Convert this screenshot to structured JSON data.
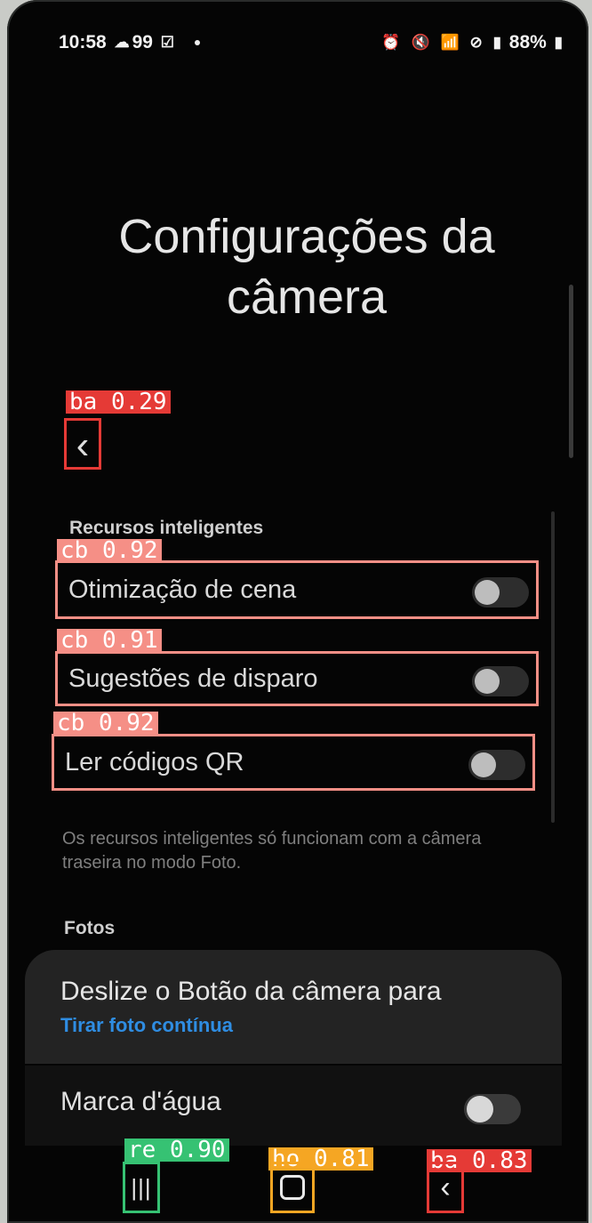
{
  "status_bar": {
    "time": "10:58",
    "left_icons": [
      "cloud-icon",
      "99",
      "check-square-icon"
    ],
    "battery": "88%",
    "right_icons": [
      "alarm-icon",
      "mute-icon",
      "wifi-icon",
      "dnd-icon",
      "volte-icon",
      "signal-icon",
      "battery-icon"
    ]
  },
  "page": {
    "title": "Configurações da câmera"
  },
  "annotations": {
    "back_top": "ba 0.29",
    "row1": "cb 0.92",
    "row2": "cb 0.91",
    "row3": "cb 0.92",
    "recent": "re 0.90",
    "home": "ho 0.81",
    "back_bottom": "ba 0.83"
  },
  "smart_features": {
    "header": "Recursos inteligentes",
    "items": [
      {
        "label": "Otimização de cena",
        "enabled": false
      },
      {
        "label": "Sugestões de disparo",
        "enabled": false
      },
      {
        "label": "Ler códigos QR",
        "enabled": false
      }
    ],
    "note": "Os recursos inteligentes só funcionam com a câmera traseira no modo Foto."
  },
  "photos": {
    "header": "Fotos",
    "swipe_title": "Deslize o Botão da câmera para",
    "swipe_value": "Tirar foto contínua",
    "watermark_label": "Marca d'água",
    "watermark_enabled": false
  },
  "colors": {
    "accent_blue": "#2f8de2",
    "box_red": "#e53a36",
    "box_salmon": "#f58f86",
    "box_green": "#36c273",
    "box_orange": "#f5a623"
  }
}
